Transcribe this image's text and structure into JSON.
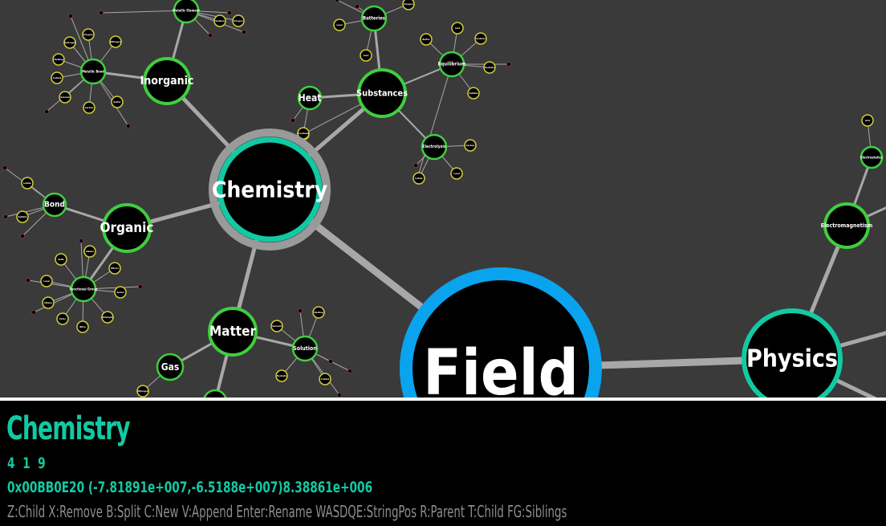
{
  "window": {
    "background": "#3a3a3a",
    "panel_background": "#000000"
  },
  "colors": {
    "edge": "#a8a8a8",
    "node_fill": "#000000",
    "node_ring_default": "#3ecf3e",
    "node_ring_leaf": "#d4cc3a",
    "node_ring_selected": "#13c9a3",
    "node_ring_root": "#0aa3ee",
    "selection_halo": "#9a9a9a",
    "info_title": "#13c9a3",
    "info_text": "#13c9a3",
    "help_text": "#8c8c8c"
  },
  "graph": {
    "root": "Field",
    "selected": "Chemistry",
    "labels": {
      "field": "Field",
      "chemistry": "Chemistry",
      "physics": "Physics",
      "inorganic": "Inorganic",
      "organic": "Organic",
      "matter": "Matter",
      "substances": "Substances",
      "heat": "Heat",
      "bond": "Bond",
      "gas": "Gas",
      "electromagnetism": "Electromagnetism",
      "electrostatics": "Electrostatics",
      "equilibrium": "Equilibrium",
      "electrolysis": "Electrolysis",
      "batteries": "Batteries",
      "solution": "Solution",
      "functional_group": "Functional Group",
      "metallic_bond": "Metallic Bond",
      "metallic_element": "Metallic Element",
      "combust": "Combust",
      "alkane": "Alkane",
      "alkene": "Alkene",
      "sulfo": "Sulfo",
      "ethers": "Ethers",
      "ester": "Ester",
      "nitro": "Nitro",
      "amine": "Amine",
      "aldehyde": "Aldehyde",
      "lead": "Lead",
      "iodide": "Iodide",
      "sulfate": "Sulfate",
      "hydrogen": "Hydrogen",
      "oxygen": "Oxygen",
      "nitrogen": "Nitrogen",
      "sulfur": "Sulfur",
      "carbon": "Carbon",
      "solvent": "Solvent",
      "colloid": "Colloid",
      "melting": "Melting",
      "buffer": "Buffer",
      "acid": "Acid",
      "sodium": "Sodium",
      "hydrate": "Hydrate"
    }
  },
  "info": {
    "title": "Chemistry",
    "counts": "4 1 9",
    "address": "0x00BB0E20 (-7.81891e+007,-6.5188e+007)8.38861e+006",
    "help": "Z:Child X:Remove B:Split C:New V:Append Enter:Rename WASDQE:StringPos R:Parent T:Child FG:Siblings"
  }
}
